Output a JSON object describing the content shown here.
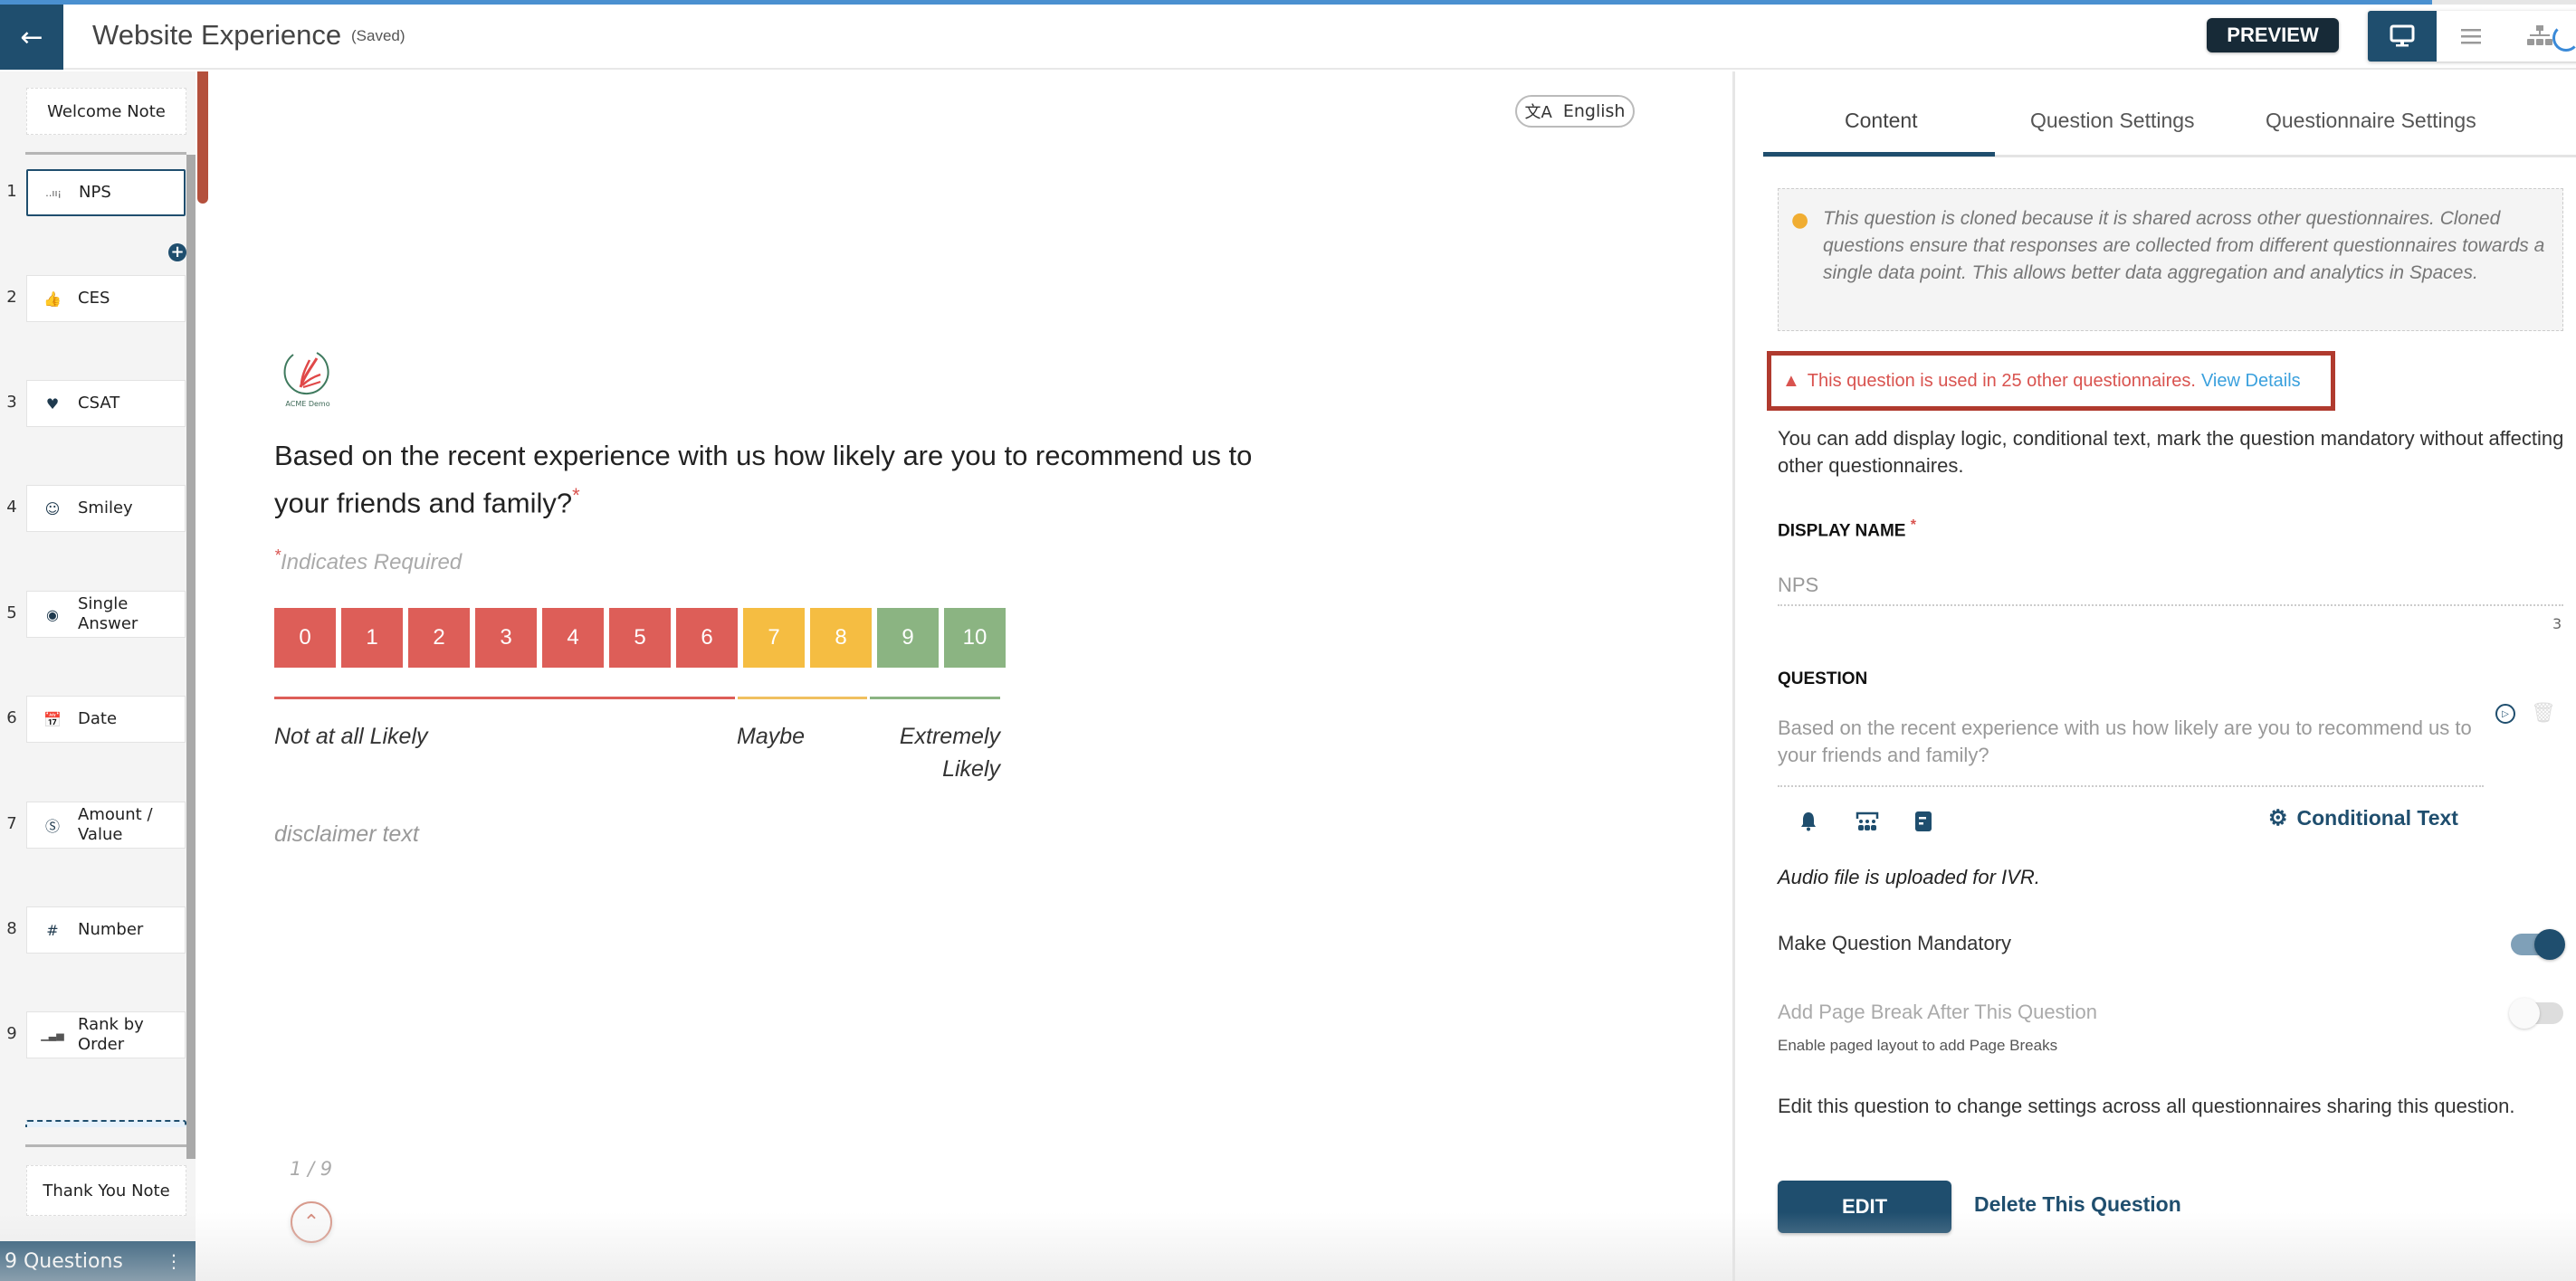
{
  "header": {
    "title": "Website Experience",
    "save_status": "(Saved)",
    "preview_label": "PREVIEW",
    "view_modes": [
      {
        "name": "desktop-view",
        "icon": "monitor-icon",
        "active": true
      },
      {
        "name": "list-view",
        "icon": "menu-icon",
        "active": false
      },
      {
        "name": "flow-view",
        "icon": "sitemap-icon",
        "active": false
      }
    ]
  },
  "sidebar": {
    "welcome_label": "Welcome Note",
    "thankyou_label": "Thank You Note",
    "question_count_label": "9 Questions",
    "items": [
      {
        "num": "1",
        "label": "NPS",
        "icon": "nps-scale-icon",
        "active": true
      },
      {
        "num": "2",
        "label": "CES",
        "icon": "thumbs-up-icon",
        "active": false
      },
      {
        "num": "3",
        "label": "CSAT",
        "icon": "heart-icon",
        "active": false
      },
      {
        "num": "4",
        "label": "Smiley",
        "icon": "smiley-icon",
        "active": false
      },
      {
        "num": "5",
        "label": "Single Answer",
        "icon": "radio-icon",
        "active": false
      },
      {
        "num": "6",
        "label": "Date",
        "icon": "calendar-icon",
        "active": false
      },
      {
        "num": "7",
        "label": "Amount / Value",
        "icon": "dollar-coin-icon",
        "active": false
      },
      {
        "num": "8",
        "label": "Number",
        "icon": "hash-icon",
        "active": false
      },
      {
        "num": "9",
        "label": "Rank by Order",
        "icon": "rank-bars-icon",
        "active": false
      }
    ]
  },
  "canvas": {
    "language": "English",
    "logo_text": "ACME Demo",
    "question": "Based on the recent experience with us how likely are you to recommend us to your friends and family?",
    "required_mark": "*",
    "indicates_required": "Indicates Required",
    "scale": {
      "values": [
        "0",
        "1",
        "2",
        "3",
        "4",
        "5",
        "6",
        "7",
        "8",
        "9",
        "10"
      ],
      "colors": [
        "#dd5e58",
        "#dd5e58",
        "#dd5e58",
        "#dd5e58",
        "#dd5e58",
        "#dd5e58",
        "#dd5e58",
        "#f5bd42",
        "#f5bd42",
        "#8bb482",
        "#8bb482"
      ],
      "labels": {
        "low": "Not at all Likely",
        "mid": "Maybe",
        "high": "Extremely Likely"
      }
    },
    "disclaimer": "disclaimer text",
    "pager": "1 / 9"
  },
  "panel": {
    "tabs": [
      {
        "label": "Content",
        "active": true
      },
      {
        "label": "Question Settings",
        "active": false
      },
      {
        "label": "Questionnaire Settings",
        "active": false
      }
    ],
    "info_text": "This question is cloned because it is shared across other questionnaires. Cloned questions ensure that responses are collected from different questionnaires towards a single data point. This allows better data aggregation and analytics in Spaces.",
    "warning_text": "This question is used in 25 other questionnaires.",
    "view_details": "View Details",
    "can_add_text": "You can add display logic, conditional text, mark the question mandatory without affecting other questionnaires.",
    "display_name_label": "DISPLAY NAME",
    "display_name_value": "NPS",
    "display_name_count": "3",
    "question_label": "QUESTION",
    "question_value": "Based on the recent experience with us how likely are you to recommend us to your friends and family?",
    "conditional_text": "Conditional Text",
    "audio_note": "Audio file is uploaded for IVR.",
    "mandatory_label": "Make Question Mandatory",
    "mandatory_on": true,
    "page_break_label": "Add Page Break After This Question",
    "page_break_on": false,
    "page_break_note": "Enable paged layout to add Page Breaks",
    "edit_note": "Edit this question to change settings across all questionnaires sharing this question.",
    "edit_label": "EDIT",
    "delete_label": "Delete This Question"
  },
  "colors": {
    "primary": "#1f4e6e",
    "danger": "#d9534f",
    "link": "#3aa0dd",
    "detractor": "#dd5e58",
    "passive": "#f5bd42",
    "promoter": "#8bb482"
  }
}
